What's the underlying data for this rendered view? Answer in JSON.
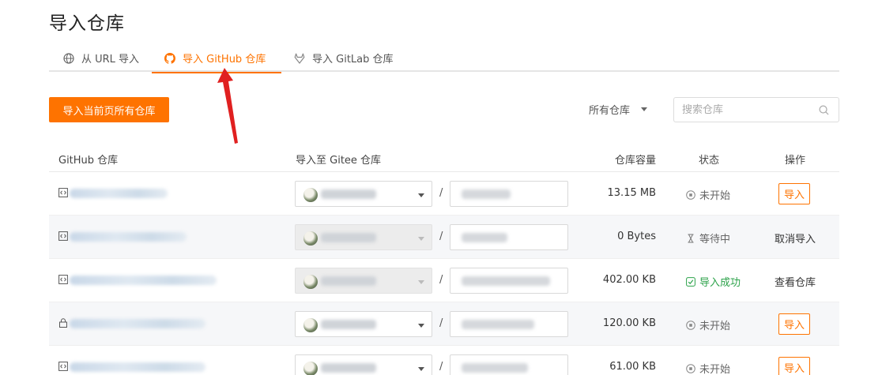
{
  "page": {
    "title": "导入仓库"
  },
  "tabs": [
    {
      "label": "从 URL 导入",
      "icon": "globe-icon"
    },
    {
      "label": "导入 GitHub 仓库",
      "icon": "github-icon",
      "active": true
    },
    {
      "label": "导入 GitLab 仓库",
      "icon": "gitlab-icon"
    }
  ],
  "toolbar": {
    "import_all_label": "导入当前页所有仓库",
    "filter_label": "所有仓库",
    "search_placeholder": "搜索仓库"
  },
  "table": {
    "headers": {
      "repo": "GitHub 仓库",
      "target": "导入至 Gitee 仓库",
      "size": "仓库容量",
      "status": "状态",
      "op": "操作"
    },
    "rows": [
      {
        "repo_icon": "code-icon",
        "size": "13.15 MB",
        "status": "未开始",
        "status_icon": "not-started-icon",
        "action": "导入",
        "action_type": "button",
        "disabled": false
      },
      {
        "repo_icon": "code-icon",
        "size": "0 Bytes",
        "status": "等待中",
        "status_icon": "hourglass-icon",
        "action": "取消导入",
        "action_type": "link",
        "disabled": true
      },
      {
        "repo_icon": "code-icon",
        "size": "402.00 KB",
        "status": "导入成功",
        "status_icon": "check-icon",
        "action": "查看仓库",
        "action_type": "link",
        "disabled": true
      },
      {
        "repo_icon": "lock-icon",
        "size": "120.00 KB",
        "status": "未开始",
        "status_icon": "not-started-icon",
        "action": "导入",
        "action_type": "button",
        "disabled": false
      },
      {
        "repo_icon": "code-icon",
        "size": "61.00 KB",
        "status": "未开始",
        "status_icon": "not-started-icon",
        "action": "导入",
        "action_type": "button",
        "disabled": false
      }
    ]
  },
  "colors": {
    "accent": "#fe7300",
    "success": "#2ca24a",
    "annotation": "#e02020"
  }
}
